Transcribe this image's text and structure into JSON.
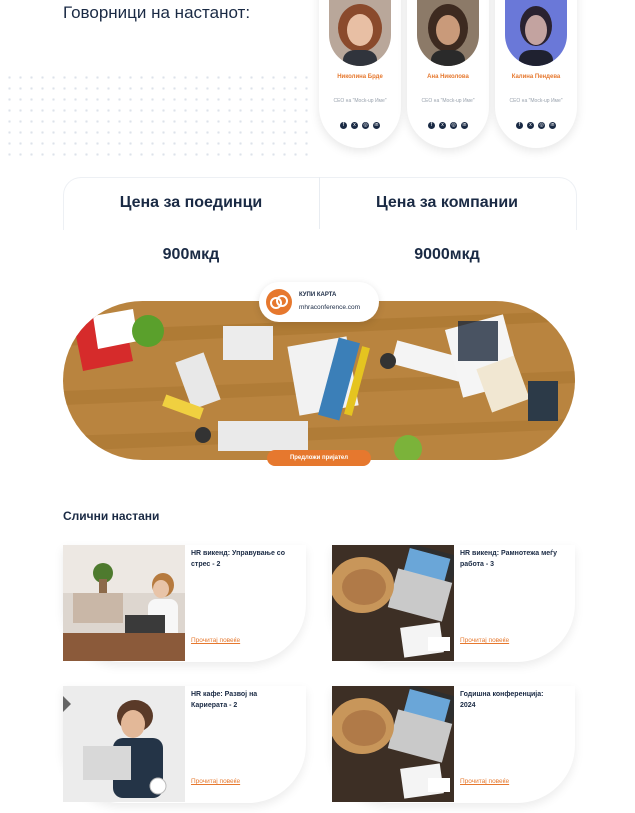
{
  "speakers": {
    "title": "Говорници на настанот:",
    "items": [
      {
        "name": "Николина Брде",
        "role": "CEO на \"Mock-up Име\""
      },
      {
        "name": "Ана Николова",
        "role": "CEO на \"Mock-up Име\""
      },
      {
        "name": "Калина Пендева",
        "role": "CEO на \"Mock-up Име\""
      }
    ],
    "social_icons": [
      "facebook-icon",
      "x-icon",
      "instagram-icon",
      "linkedin-icon"
    ]
  },
  "pricing": {
    "individual_label": "Цена за поединци",
    "individual_price": "900мкд",
    "company_label": "Цена за компании",
    "company_price": "9000мкд"
  },
  "ticket": {
    "title": "КУПИ КАРТА",
    "site": "mhraconference.com"
  },
  "suggest_button": "Предложи пријател",
  "similar": {
    "title": "Слични настани",
    "link_label": "Прочитај повеќе",
    "events": [
      {
        "title": "HR викенд: Управување со стрес - 2"
      },
      {
        "title": "HR викенд: Рамнотежа меѓу работа - 3"
      },
      {
        "title": "HR кафе: Развој на Кариерата - 2"
      },
      {
        "title": "Годишна конференција: 2024"
      }
    ]
  },
  "colors": {
    "accent": "#e6782e",
    "navy": "#1a2a44"
  }
}
